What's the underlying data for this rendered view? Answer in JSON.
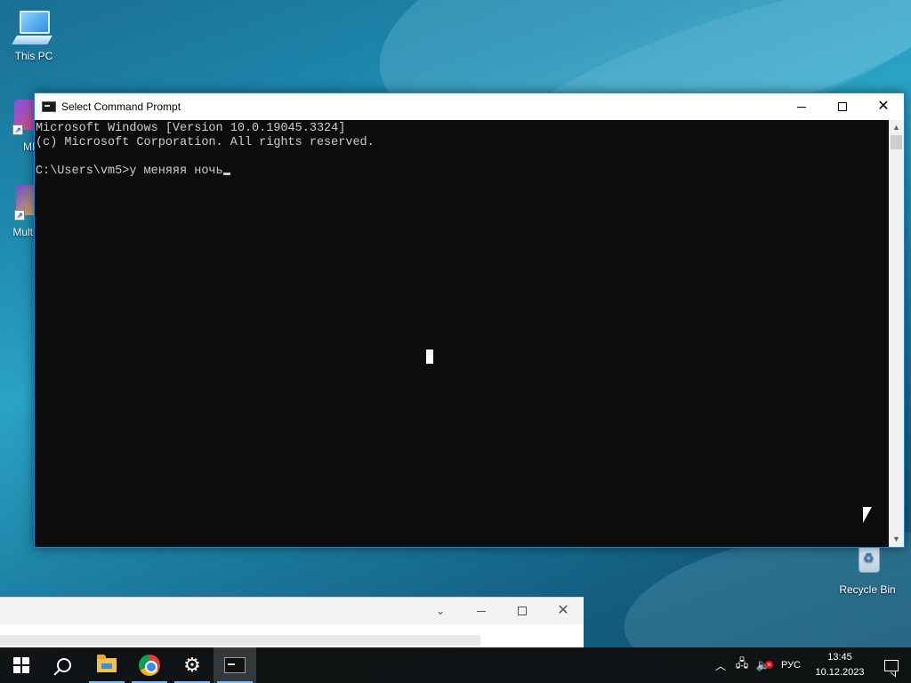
{
  "desktop": {
    "icons": [
      {
        "label": "This PC",
        "icon": "monitor-icon"
      },
      {
        "label": "ME",
        "icon": "app-shortcut-icon"
      },
      {
        "label": "Multi-",
        "icon": "app-shortcut-icon"
      },
      {
        "label": "Recycle Bin",
        "icon": "recycle-bin-icon"
      }
    ]
  },
  "cmd_window": {
    "title": "Select Command Prompt",
    "lines": [
      "Microsoft Windows [Version 10.0.19045.3324]",
      "(c) Microsoft Corporation. All rights reserved.",
      "",
      "C:\\Users\\vm5>у меняяя ночь"
    ],
    "colors": {
      "background": "#0c0c0c",
      "text": "#cccccc",
      "border": "#1883d7"
    }
  },
  "taskbar": {
    "items": [
      "start-icon",
      "search-icon",
      "file-explorer-icon",
      "chrome-icon",
      "settings-icon",
      "command-prompt-icon"
    ],
    "tray": {
      "language": "РУС",
      "time": "13:45",
      "date": "10.12.2023"
    }
  }
}
